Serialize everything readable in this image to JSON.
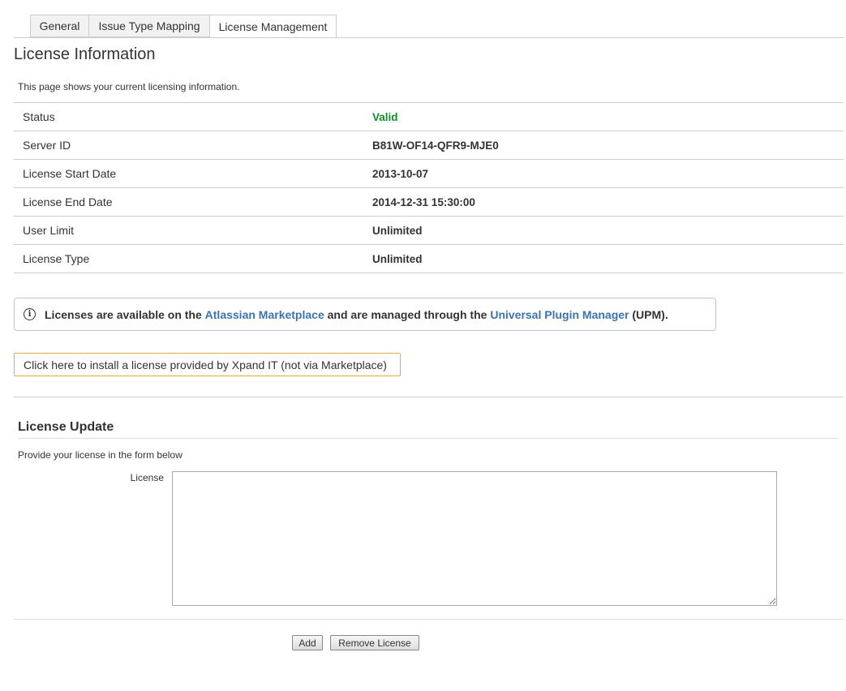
{
  "tabs": [
    {
      "label": "General"
    },
    {
      "label": "Issue Type Mapping"
    },
    {
      "label": "License Management",
      "active": true
    }
  ],
  "license_info": {
    "title": "License Information",
    "description": "This page shows your current licensing information.",
    "rows": [
      {
        "label": "Status",
        "value": "Valid"
      },
      {
        "label": "Server ID",
        "value": "B81W-OF14-QFR9-MJE0"
      },
      {
        "label": "License Start Date",
        "value": "2013-10-07"
      },
      {
        "label": "License End Date",
        "value": "2014-12-31 15:30:00"
      },
      {
        "label": "User Limit",
        "value": "Unlimited"
      },
      {
        "label": "License Type",
        "value": "Unlimited"
      }
    ],
    "status_color": "#14892c"
  },
  "notice": {
    "icon": "info-icon",
    "text_1": "Licenses are available on the ",
    "link_1": "Atlassian Marketplace",
    "text_2": " and are managed through the ",
    "link_2": "Universal Plugin Manager",
    "text_3": " (UPM).",
    "link_color": "#3b73af"
  },
  "install_link": "Click here to install a license provided by Xpand IT (not via Marketplace)",
  "license_update": {
    "title": "License Update",
    "description": "Provide your license in the form below",
    "field_label": "License",
    "field_value": ""
  },
  "buttons": {
    "add": "Add",
    "remove": "Remove License"
  }
}
